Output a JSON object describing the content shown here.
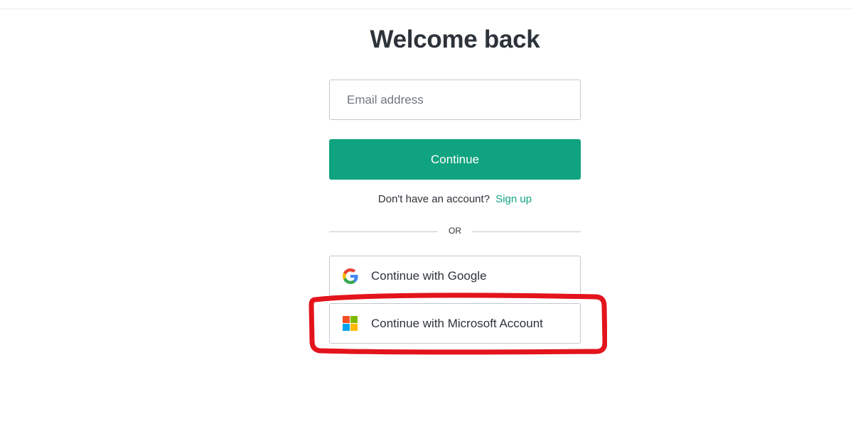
{
  "page": {
    "title": "Welcome back"
  },
  "email": {
    "placeholder": "Email address",
    "value": ""
  },
  "continue_button": {
    "label": "Continue"
  },
  "signup": {
    "prompt": "Don't have an account?",
    "link_label": "Sign up"
  },
  "divider": {
    "label": "OR"
  },
  "social": {
    "google_label": "Continue with Google",
    "microsoft_label": "Continue with Microsoft Account"
  },
  "icons": {
    "google": "google-logo-icon",
    "microsoft": "microsoft-logo-icon"
  },
  "colors": {
    "accent": "#10a37f",
    "highlight": "#e3141c",
    "border": "#c2c8d0",
    "text": "#2d333a"
  }
}
